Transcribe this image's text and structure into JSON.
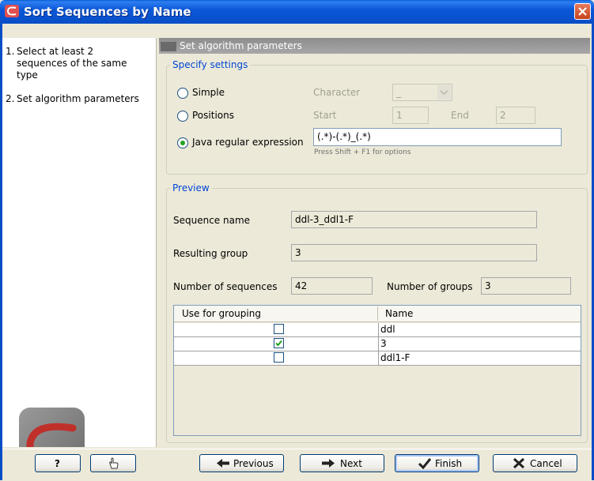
{
  "window": {
    "title": "Sort Sequences by Name"
  },
  "steps": [
    {
      "num": "1.",
      "lines": [
        "Select at least 2",
        "sequences of the same",
        "type"
      ]
    },
    {
      "num": "2.",
      "lines": [
        "Set algorithm parameters"
      ]
    }
  ],
  "section_title": "Set algorithm parameters",
  "settings": {
    "legend": "Specify settings",
    "simple_label": "Simple",
    "character_label": "Character",
    "character_value": "_",
    "positions_label": "Positions",
    "start_label": "Start",
    "start_value": "1",
    "end_label": "End",
    "end_value": "2",
    "regex_label": "Java regular expression",
    "regex_value": "(.*)-(.*)_(.*)",
    "regex_hint": "Press Shift + F1 for options",
    "selected_option": "Java regular expression"
  },
  "preview": {
    "legend": "Preview",
    "sequence_name_label": "Sequence name",
    "sequence_name_value": "ddl-3_ddl1-F",
    "resulting_group_label": "Resulting group",
    "resulting_group_value": "3",
    "num_sequences_label": "Number of sequences",
    "num_sequences_value": "42",
    "num_groups_label": "Number of groups",
    "num_groups_value": "3",
    "table": {
      "columns": [
        "Use for grouping",
        "Name"
      ],
      "rows": [
        {
          "checked": false,
          "name": "ddl"
        },
        {
          "checked": true,
          "name": "3"
        },
        {
          "checked": false,
          "name": "ddl1-F"
        }
      ]
    }
  },
  "buttons": {
    "help": "?",
    "previous": "Previous",
    "next": "Next",
    "finish": "Finish",
    "cancel": "Cancel"
  },
  "colors": {
    "title_bar": "#0a58d8",
    "legend": "#0046d5",
    "check": "#21a121"
  }
}
